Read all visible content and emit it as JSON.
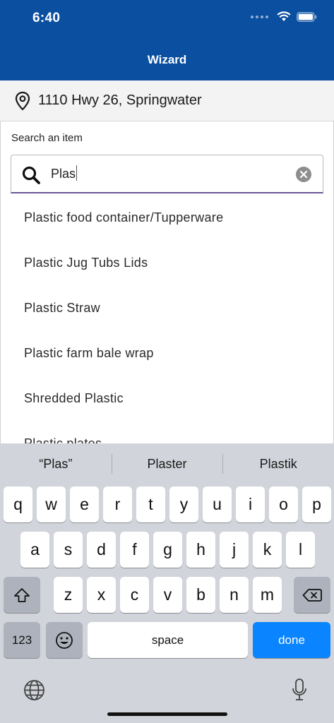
{
  "status": {
    "time": "6:40"
  },
  "nav": {
    "title": "Wizard"
  },
  "address": {
    "text": "1110 Hwy 26, Springwater",
    "icon": "location-pin-icon"
  },
  "search": {
    "label": "Search an item",
    "value": "Plas"
  },
  "results": [
    "Plastic food container/Tupperware",
    "Plastic Jug Tubs Lids",
    "Plastic Straw",
    "Plastic farm bale wrap",
    "Shredded Plastic",
    "Plastic plates"
  ],
  "keyboard": {
    "suggestions": [
      "“Plas”",
      "Plaster",
      "Plastik"
    ],
    "row1": [
      "q",
      "w",
      "e",
      "r",
      "t",
      "y",
      "u",
      "i",
      "o",
      "p"
    ],
    "row2": [
      "a",
      "s",
      "d",
      "f",
      "g",
      "h",
      "j",
      "k",
      "l"
    ],
    "row3": [
      "z",
      "x",
      "c",
      "v",
      "b",
      "n",
      "m"
    ],
    "numbers_label": "123",
    "space_label": "space",
    "done_label": "done"
  },
  "colors": {
    "header": "#0a4fa0",
    "accent_underline": "#6c5596",
    "done_key": "#0a84ff"
  }
}
